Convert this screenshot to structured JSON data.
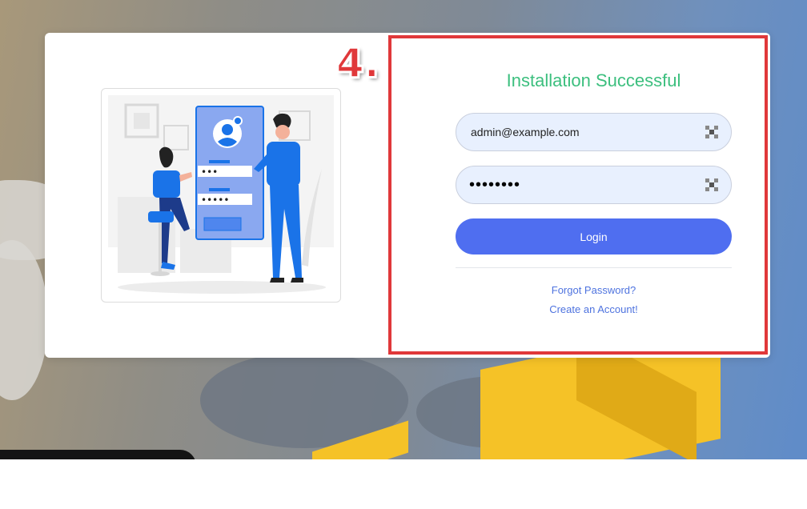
{
  "step_marker": "4.",
  "login": {
    "title": "Installation Successful",
    "email_value": "admin@example.com",
    "password_value": "••••••••",
    "login_label": "Login",
    "forgot_label": "Forgot Password?",
    "create_label": "Create an Account!"
  },
  "icons": {
    "field_icon": "autofill-key-icon"
  },
  "colors": {
    "title": "#3cbf7e",
    "button": "#4f6ef0",
    "link": "#4e73df",
    "highlight": "#e0383a"
  }
}
